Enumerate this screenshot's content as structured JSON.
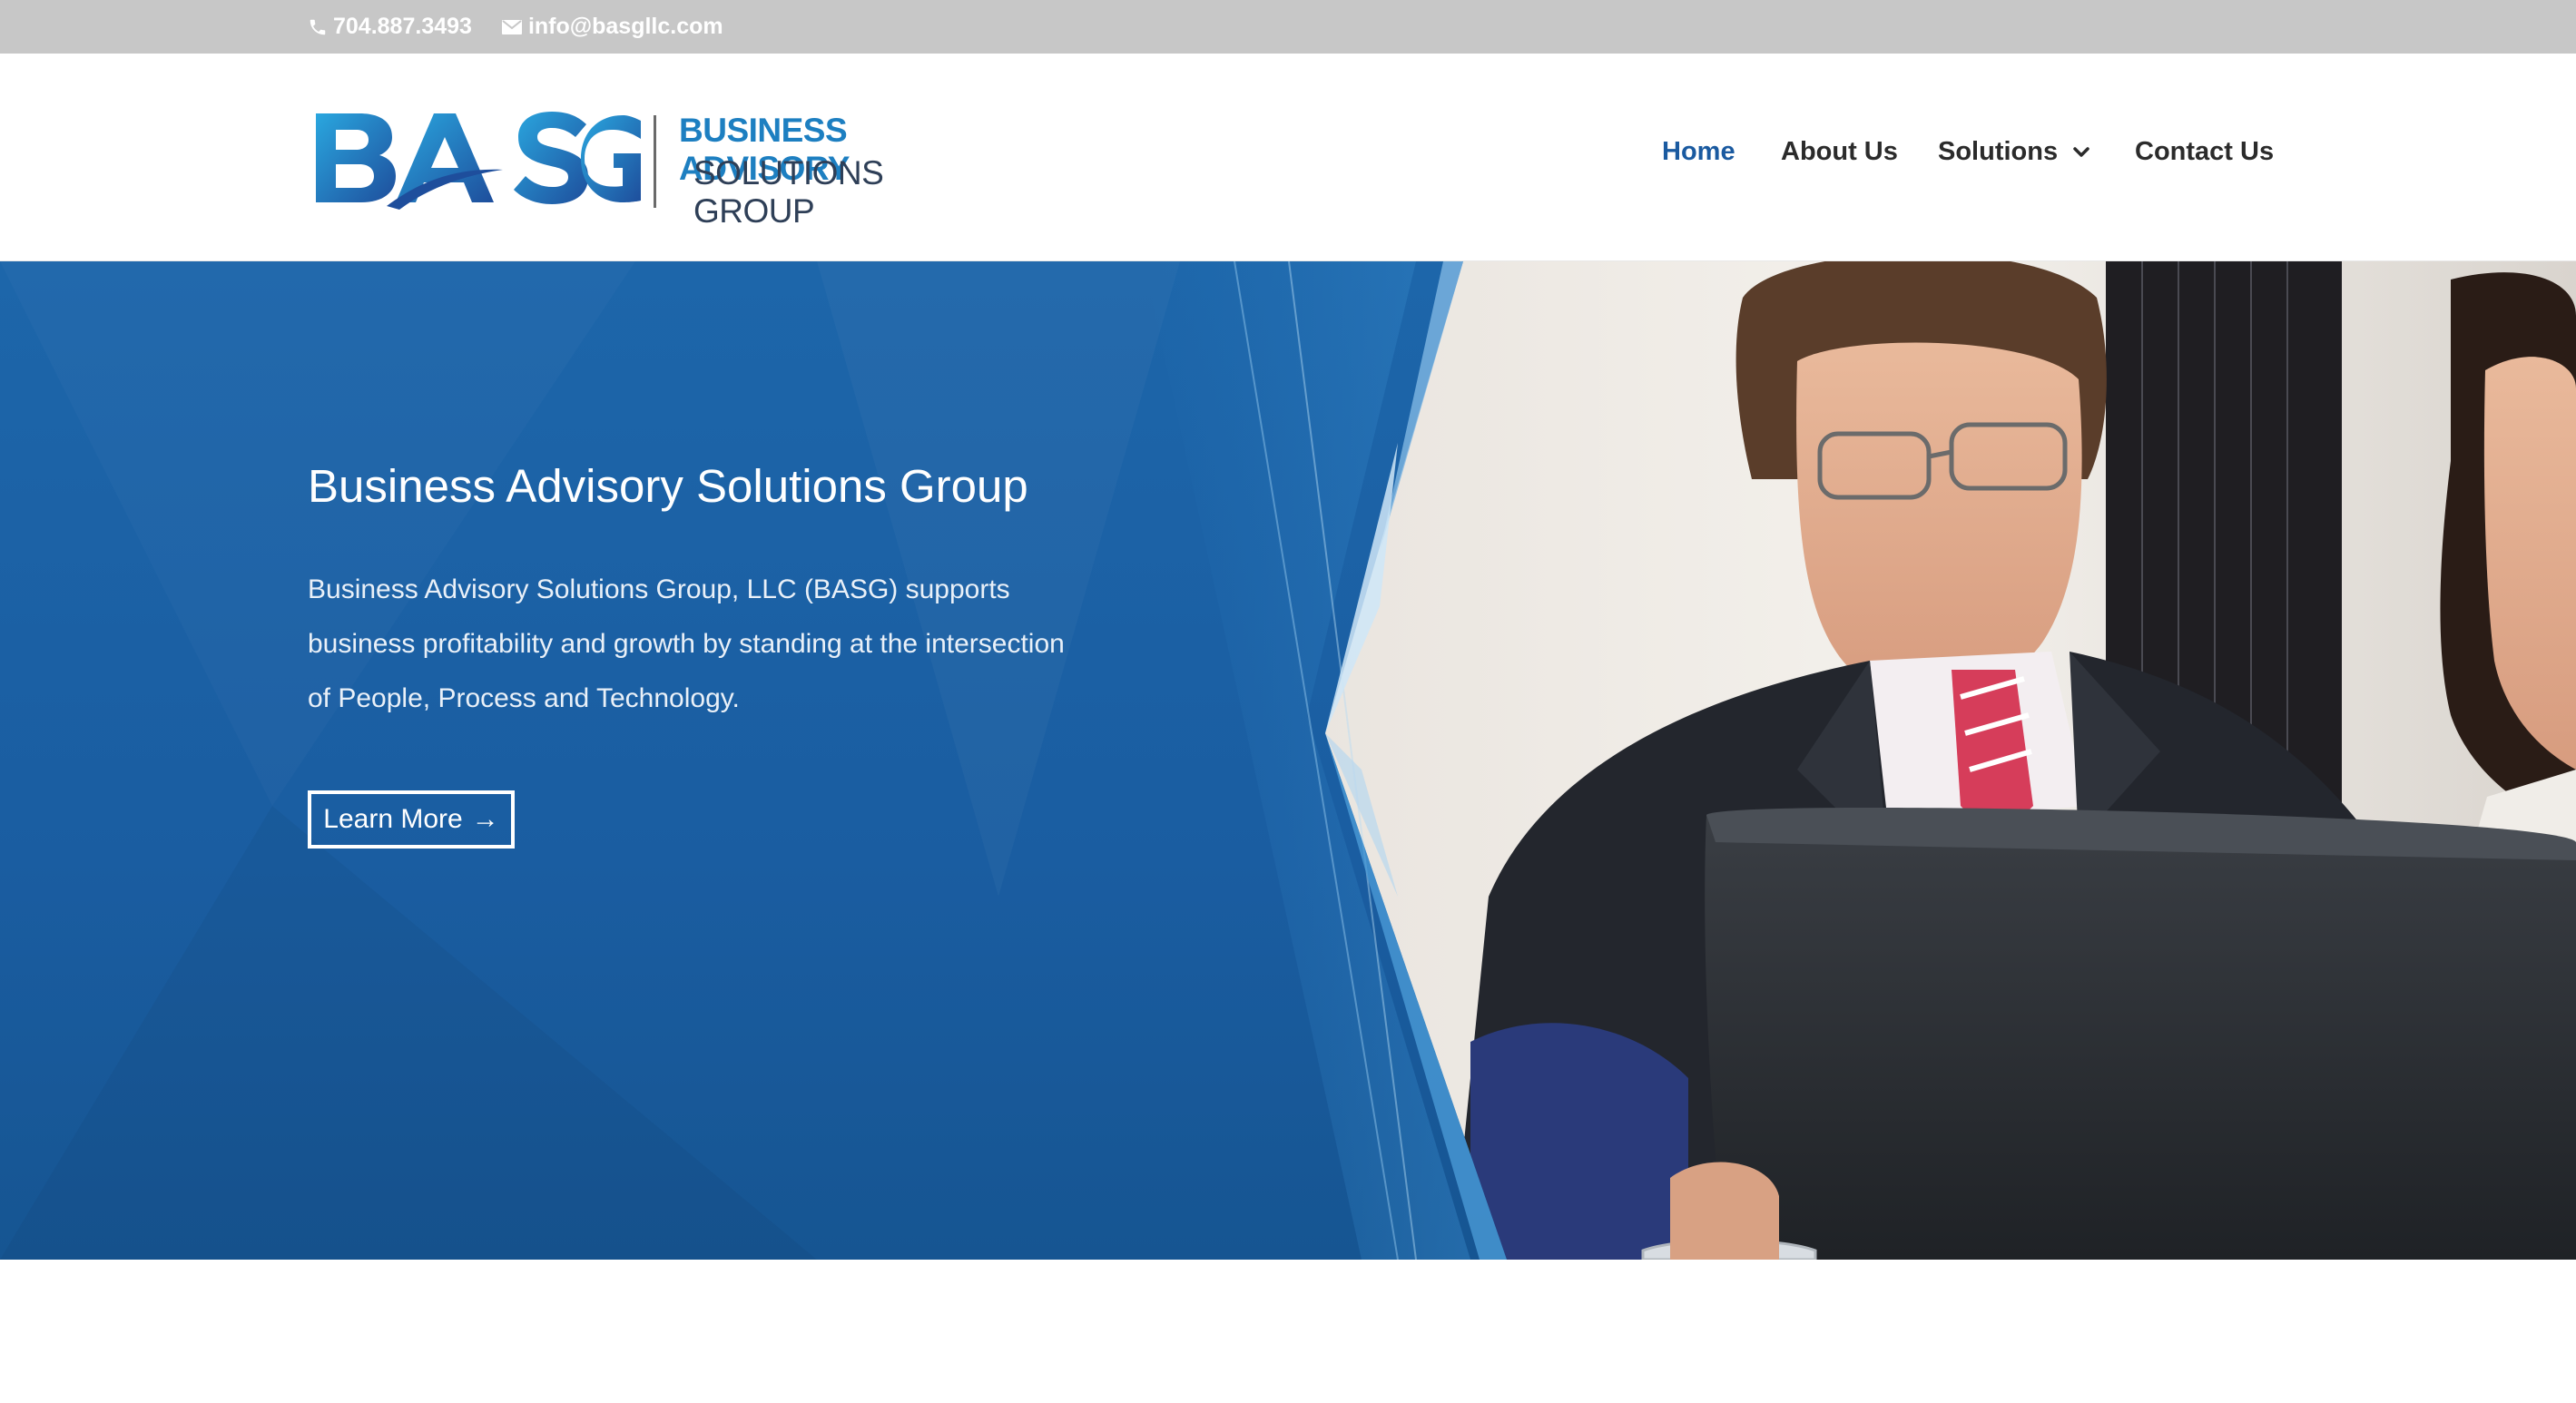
{
  "topbar": {
    "phone": "704.887.3493",
    "email": "info@basgllc.com",
    "icons": [
      "phone-icon",
      "envelope-icon"
    ]
  },
  "header": {
    "logo": {
      "mark": "BASG",
      "line1": "BUSINESS ADVISORY",
      "line2": "SOLUTIONS GROUP"
    },
    "nav": {
      "items": [
        {
          "label": "Home",
          "active": true
        },
        {
          "label": "About Us",
          "active": false
        },
        {
          "label": "Solutions",
          "active": false,
          "has_dropdown": true
        },
        {
          "label": "Contact Us",
          "active": false
        }
      ]
    }
  },
  "hero": {
    "title": "Business Advisory Solutions Group",
    "description_lines": [
      "Business Advisory Solutions Group, LLC  (BASG) supports",
      "business profitability and growth by standing at the intersection",
      "of People, Process and Technology."
    ],
    "button_label": "Learn More",
    "button_arrow": "→"
  },
  "colors": {
    "topbar": "#c7c7c7",
    "brand_blue": "#1d5fae",
    "nav_active": "#1a5aa0",
    "hero_blue": "#1b62a8"
  }
}
